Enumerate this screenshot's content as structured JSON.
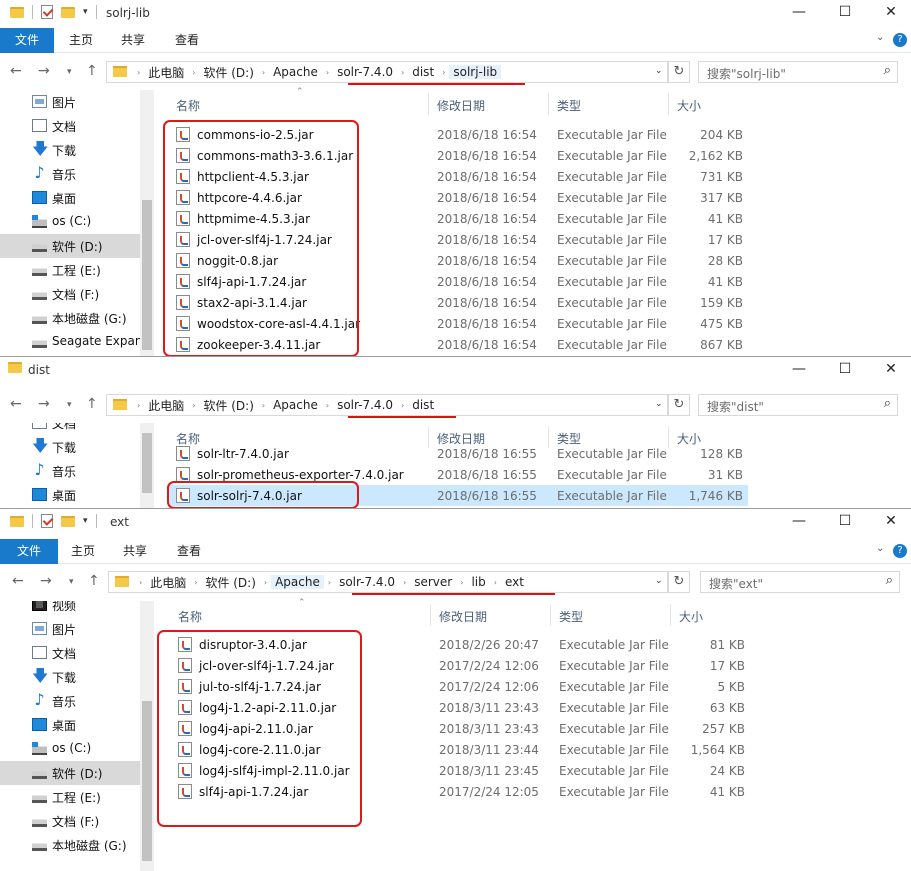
{
  "windows": [
    {
      "id": "w1",
      "title": "solrj-lib",
      "tabs": [
        "文件",
        "主页",
        "共享",
        "查看"
      ],
      "path": [
        "此电脑",
        "软件 (D:)",
        "Apache",
        "solr-7.4.0",
        "dist",
        "solrj-lib"
      ],
      "search_placeholder": "搜索\"solrj-lib\"",
      "columns": [
        "名称",
        "修改日期",
        "类型",
        "大小"
      ],
      "nav": [
        "图片",
        "文档",
        "下载",
        "音乐",
        "桌面",
        "os (C:)",
        "软件 (D:)",
        "工程 (E:)",
        "文档 (F:)",
        "本地磁盘 (G:)",
        "Seagate Expan"
      ],
      "nav_icons": [
        "picture-icon",
        "document-icon",
        "download-icon",
        "music-icon",
        "desktop-icon",
        "os-drive-icon",
        "drive-icon",
        "drive-icon",
        "drive-icon",
        "drive-icon",
        "drive-icon"
      ],
      "files": [
        {
          "name": "commons-io-2.5.jar",
          "date": "2018/6/18 16:54",
          "type": "Executable Jar File",
          "size": "204 KB"
        },
        {
          "name": "commons-math3-3.6.1.jar",
          "date": "2018/6/18 16:54",
          "type": "Executable Jar File",
          "size": "2,162 KB"
        },
        {
          "name": "httpclient-4.5.3.jar",
          "date": "2018/6/18 16:54",
          "type": "Executable Jar File",
          "size": "731 KB"
        },
        {
          "name": "httpcore-4.4.6.jar",
          "date": "2018/6/18 16:54",
          "type": "Executable Jar File",
          "size": "317 KB"
        },
        {
          "name": "httpmime-4.5.3.jar",
          "date": "2018/6/18 16:54",
          "type": "Executable Jar File",
          "size": "41 KB"
        },
        {
          "name": "jcl-over-slf4j-1.7.24.jar",
          "date": "2018/6/18 16:54",
          "type": "Executable Jar File",
          "size": "17 KB"
        },
        {
          "name": "noggit-0.8.jar",
          "date": "2018/6/18 16:54",
          "type": "Executable Jar File",
          "size": "28 KB"
        },
        {
          "name": "slf4j-api-1.7.24.jar",
          "date": "2018/6/18 16:54",
          "type": "Executable Jar File",
          "size": "41 KB"
        },
        {
          "name": "stax2-api-3.1.4.jar",
          "date": "2018/6/18 16:54",
          "type": "Executable Jar File",
          "size": "159 KB"
        },
        {
          "name": "woodstox-core-asl-4.4.1.jar",
          "date": "2018/6/18 16:54",
          "type": "Executable Jar File",
          "size": "475 KB"
        },
        {
          "name": "zookeeper-3.4.11.jar",
          "date": "2018/6/18 16:54",
          "type": "Executable Jar File",
          "size": "867 KB"
        }
      ]
    },
    {
      "id": "w2",
      "title": "dist",
      "path": [
        "此电脑",
        "软件 (D:)",
        "Apache",
        "solr-7.4.0",
        "dist"
      ],
      "search_placeholder": "搜索\"dist\"",
      "columns": [
        "名称",
        "修改日期",
        "类型",
        "大小"
      ],
      "nav": [
        "文档",
        "下载",
        "音乐",
        "桌面"
      ],
      "nav_icons": [
        "document-icon",
        "download-icon",
        "music-icon",
        "desktop-icon"
      ],
      "files": [
        {
          "name": "solr-ltr-7.4.0.jar",
          "date": "2018/6/18 16:55",
          "type": "Executable Jar File",
          "size": "128 KB"
        },
        {
          "name": "solr-prometheus-exporter-7.4.0.jar",
          "date": "2018/6/18 16:55",
          "type": "Executable Jar File",
          "size": "31 KB"
        },
        {
          "name": "solr-solrj-7.4.0.jar",
          "date": "2018/6/18 16:55",
          "type": "Executable Jar File",
          "size": "1,746 KB"
        }
      ]
    },
    {
      "id": "w3",
      "title": "ext",
      "tabs": [
        "文件",
        "主页",
        "共享",
        "查看"
      ],
      "path": [
        "此电脑",
        "软件 (D:)",
        "Apache",
        "solr-7.4.0",
        "server",
        "lib",
        "ext"
      ],
      "search_placeholder": "搜索\"ext\"",
      "columns": [
        "名称",
        "修改日期",
        "类型",
        "大小"
      ],
      "nav": [
        "视频",
        "图片",
        "文档",
        "下载",
        "音乐",
        "桌面",
        "os (C:)",
        "软件 (D:)",
        "工程 (E:)",
        "文档 (F:)",
        "本地磁盘 (G:)"
      ],
      "nav_icons": [
        "video-icon",
        "picture-icon",
        "document-icon",
        "download-icon",
        "music-icon",
        "desktop-icon",
        "os-drive-icon",
        "drive-icon",
        "drive-icon",
        "drive-icon",
        "drive-icon"
      ],
      "files": [
        {
          "name": "disruptor-3.4.0.jar",
          "date": "2018/2/26 20:47",
          "type": "Executable Jar File",
          "size": "81 KB"
        },
        {
          "name": "jcl-over-slf4j-1.7.24.jar",
          "date": "2017/2/24 12:06",
          "type": "Executable Jar File",
          "size": "17 KB"
        },
        {
          "name": "jul-to-slf4j-1.7.24.jar",
          "date": "2017/2/24 12:06",
          "type": "Executable Jar File",
          "size": "5 KB"
        },
        {
          "name": "log4j-1.2-api-2.11.0.jar",
          "date": "2018/3/11 23:43",
          "type": "Executable Jar File",
          "size": "63 KB"
        },
        {
          "name": "log4j-api-2.11.0.jar",
          "date": "2018/3/11 23:43",
          "type": "Executable Jar File",
          "size": "257 KB"
        },
        {
          "name": "log4j-core-2.11.0.jar",
          "date": "2018/3/11 23:44",
          "type": "Executable Jar File",
          "size": "1,564 KB"
        },
        {
          "name": "log4j-slf4j-impl-2.11.0.jar",
          "date": "2018/3/11 23:45",
          "type": "Executable Jar File",
          "size": "24 KB"
        },
        {
          "name": "slf4j-api-1.7.24.jar",
          "date": "2017/2/24 12:05",
          "type": "Executable Jar File",
          "size": "41 KB"
        }
      ]
    }
  ],
  "window_controls": {
    "minimize": "—",
    "maximize": "☐",
    "close": "✕"
  },
  "colors": {
    "accent": "#1979ca",
    "annotation": "#e01818",
    "selection": "#cce8ff"
  }
}
